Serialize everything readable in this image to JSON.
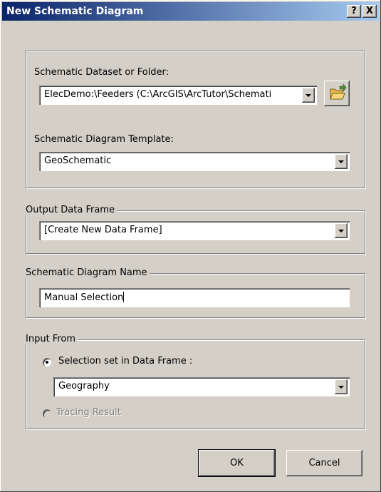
{
  "window": {
    "title": "New Schematic Diagram",
    "help_label": "?",
    "close_label": "X"
  },
  "dataset": {
    "label": "Schematic Dataset or Folder:",
    "value": "ElecDemo:\\Feeders (C:\\ArcGIS\\ArcTutor\\Schemati",
    "browse_icon": "open-folder-icon"
  },
  "template": {
    "label": "Schematic Diagram Template:",
    "value": "GeoSchematic"
  },
  "output_frame": {
    "legend": "Output Data Frame",
    "value": "[Create New Data Frame]"
  },
  "diagram_name": {
    "legend": "Schematic Diagram Name",
    "value": "Manual Selection"
  },
  "input_from": {
    "legend": "Input From",
    "selection_label": "Selection set in Data Frame :",
    "selection_checked": true,
    "frame_value": "Geography",
    "tracing_label": "Tracing Result",
    "tracing_enabled": false
  },
  "buttons": {
    "ok": "OK",
    "cancel": "Cancel"
  },
  "colors": {
    "title_start": "#0a246a",
    "title_end": "#a6caf0",
    "face": "#d4d0c8"
  }
}
